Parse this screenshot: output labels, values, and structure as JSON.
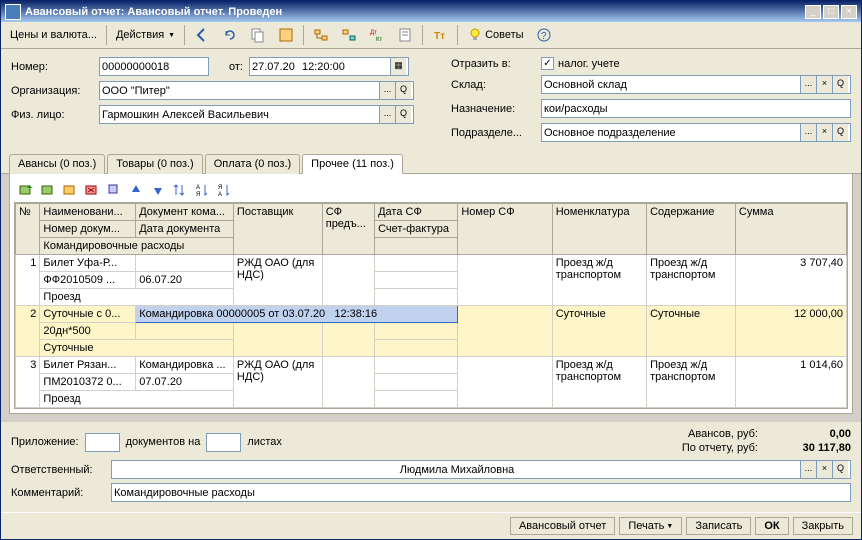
{
  "window": {
    "title": "Авансовый отчет: Авансовый отчет. Проведен"
  },
  "toolbar": {
    "prices": "Цены и валюта...",
    "actions": "Действия",
    "advice": "Советы"
  },
  "form": {
    "number_label": "Номер:",
    "number": "00000000018",
    "from_label": "от:",
    "date": "27.07.20",
    "time": "12:20:00",
    "org_label": "Организация:",
    "org": "ООО \"Питер\"",
    "person_label": "Физ. лицо:",
    "person": "Гармошкин Алексей Васильевич",
    "reflect_label": "Отразить в:",
    "tax_label": "налог. учете",
    "warehouse_label": "Склад:",
    "warehouse": "Основной склад",
    "purpose_label": "Назначение:",
    "purpose": "кои/расходы",
    "dept_label": "Подразделе...",
    "dept": "Основное подразделение"
  },
  "tabs": {
    "t1": "Авансы (0 поз.)",
    "t2": "Товары (0 поз.)",
    "t3": "Оплата (0 поз.)",
    "t4": "Прочее (11 поз.)"
  },
  "grid": {
    "headers": {
      "n": "№",
      "name": "Наименовани...",
      "doc": "Документ кома...",
      "supplier": "Поставщик",
      "sf": "СФ предъ...",
      "sfdate": "Дата СФ",
      "sfnum": "Номер СФ",
      "nomen": "Номенклатура",
      "content": "Содержание",
      "sum": "Сумма",
      "docnum": "Номер докум...",
      "docdate": "Дата документа",
      "invoice": "Счет-фактура",
      "trip": "Командировочные расходы"
    },
    "rows": [
      {
        "n": "1",
        "name": "Билет Уфа-Р...",
        "doc": "",
        "supplier": "РЖД ОАО (для НДС)",
        "nomen": "Проезд ж/д транспортом",
        "content": "Проезд ж/д транспортом",
        "sum": "3 707,40",
        "docnum": "ФФ2010509 ...",
        "docdate": "06.07.20",
        "third": "Проезд"
      },
      {
        "n": "2",
        "name": "Суточные с 0...",
        "doc": "Командировка 00000005 от 03.07.20",
        "doctime": "12:38:16",
        "nomen": "Суточные",
        "content": "Суточные",
        "sum": "12 000,00",
        "docnum": "20дн*500",
        "third": "Суточные"
      },
      {
        "n": "3",
        "name": "Билет Рязан...",
        "doc": "Командировка ...",
        "supplier": "РЖД ОАО (для НДС)",
        "nomen": "Проезд ж/д транспортом",
        "content": "Проезд ж/д транспортом",
        "sum": "1 014,60",
        "docnum": "ПМ2010372 0...",
        "docdate": "07.07.20",
        "third": "Проезд"
      }
    ]
  },
  "bottom": {
    "attach_label": "Приложение:",
    "docs_label": "документов на",
    "sheets_label": "листах",
    "advances_label": "Авансов, руб:",
    "advances": "0,00",
    "report_label": "По отчету, руб:",
    "report": "30 117,80",
    "resp_label": "Ответственный:",
    "resp": "Людмила Михайловна",
    "comment_label": "Комментарий:",
    "comment": "Командировочные расходы"
  },
  "footer": {
    "report": "Авансовый отчет",
    "print": "Печать",
    "save": "Записать",
    "ok": "ОК",
    "close": "Закрыть"
  }
}
